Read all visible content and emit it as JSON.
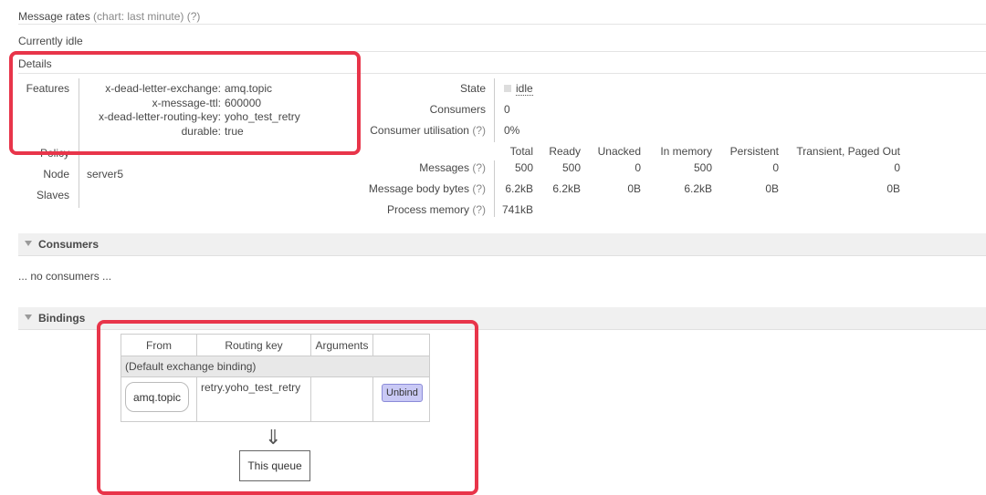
{
  "top": {
    "message_rates_label": "Message rates",
    "message_rates_hint": "(chart: last minute) (?)",
    "currently_idle": "Currently idle"
  },
  "details": {
    "title": "Details",
    "features_label": "Features",
    "features": [
      {
        "key": "x-dead-letter-exchange:",
        "value": "amq.topic"
      },
      {
        "key": "x-message-ttl:",
        "value": "600000"
      },
      {
        "key": "x-dead-letter-routing-key:",
        "value": "yoho_test_retry"
      },
      {
        "key": "durable:",
        "value": "true"
      }
    ],
    "policy_label": "Policy",
    "node_label": "Node",
    "node_value": "server5",
    "slaves_label": "Slaves",
    "state_label": "State",
    "state_value": "idle",
    "consumers_label": "Consumers",
    "consumers_value": "0",
    "utilisation_label": "Consumer utilisation",
    "utilisation_hint": "(?)",
    "utilisation_value": "0%",
    "stats": {
      "headers": [
        "Total",
        "Ready",
        "Unacked",
        "In memory",
        "Persistent",
        "Transient, Paged Out"
      ],
      "rows": [
        {
          "label": "Messages",
          "hint": "(?)",
          "values": [
            "500",
            "500",
            "0",
            "500",
            "0",
            "0"
          ]
        },
        {
          "label": "Message body bytes",
          "hint": "(?)",
          "values": [
            "6.2kB",
            "6.2kB",
            "0B",
            "6.2kB",
            "0B",
            "0B"
          ]
        },
        {
          "label": "Process memory",
          "hint": "(?)",
          "values": [
            "741kB"
          ]
        }
      ]
    }
  },
  "consumers": {
    "title": "Consumers",
    "empty": "... no consumers ..."
  },
  "bindings": {
    "title": "Bindings",
    "columns": [
      "From",
      "Routing key",
      "Arguments"
    ],
    "default_binding": "(Default exchange binding)",
    "row": {
      "from": "amq.topic",
      "routing_key": "retry.yoho_test_retry",
      "arguments": "",
      "action": "Unbind"
    },
    "arrow": "⇓",
    "this_queue": "This queue"
  },
  "colors": {
    "highlight": "#e8354a",
    "button": "#c9c9f5"
  }
}
